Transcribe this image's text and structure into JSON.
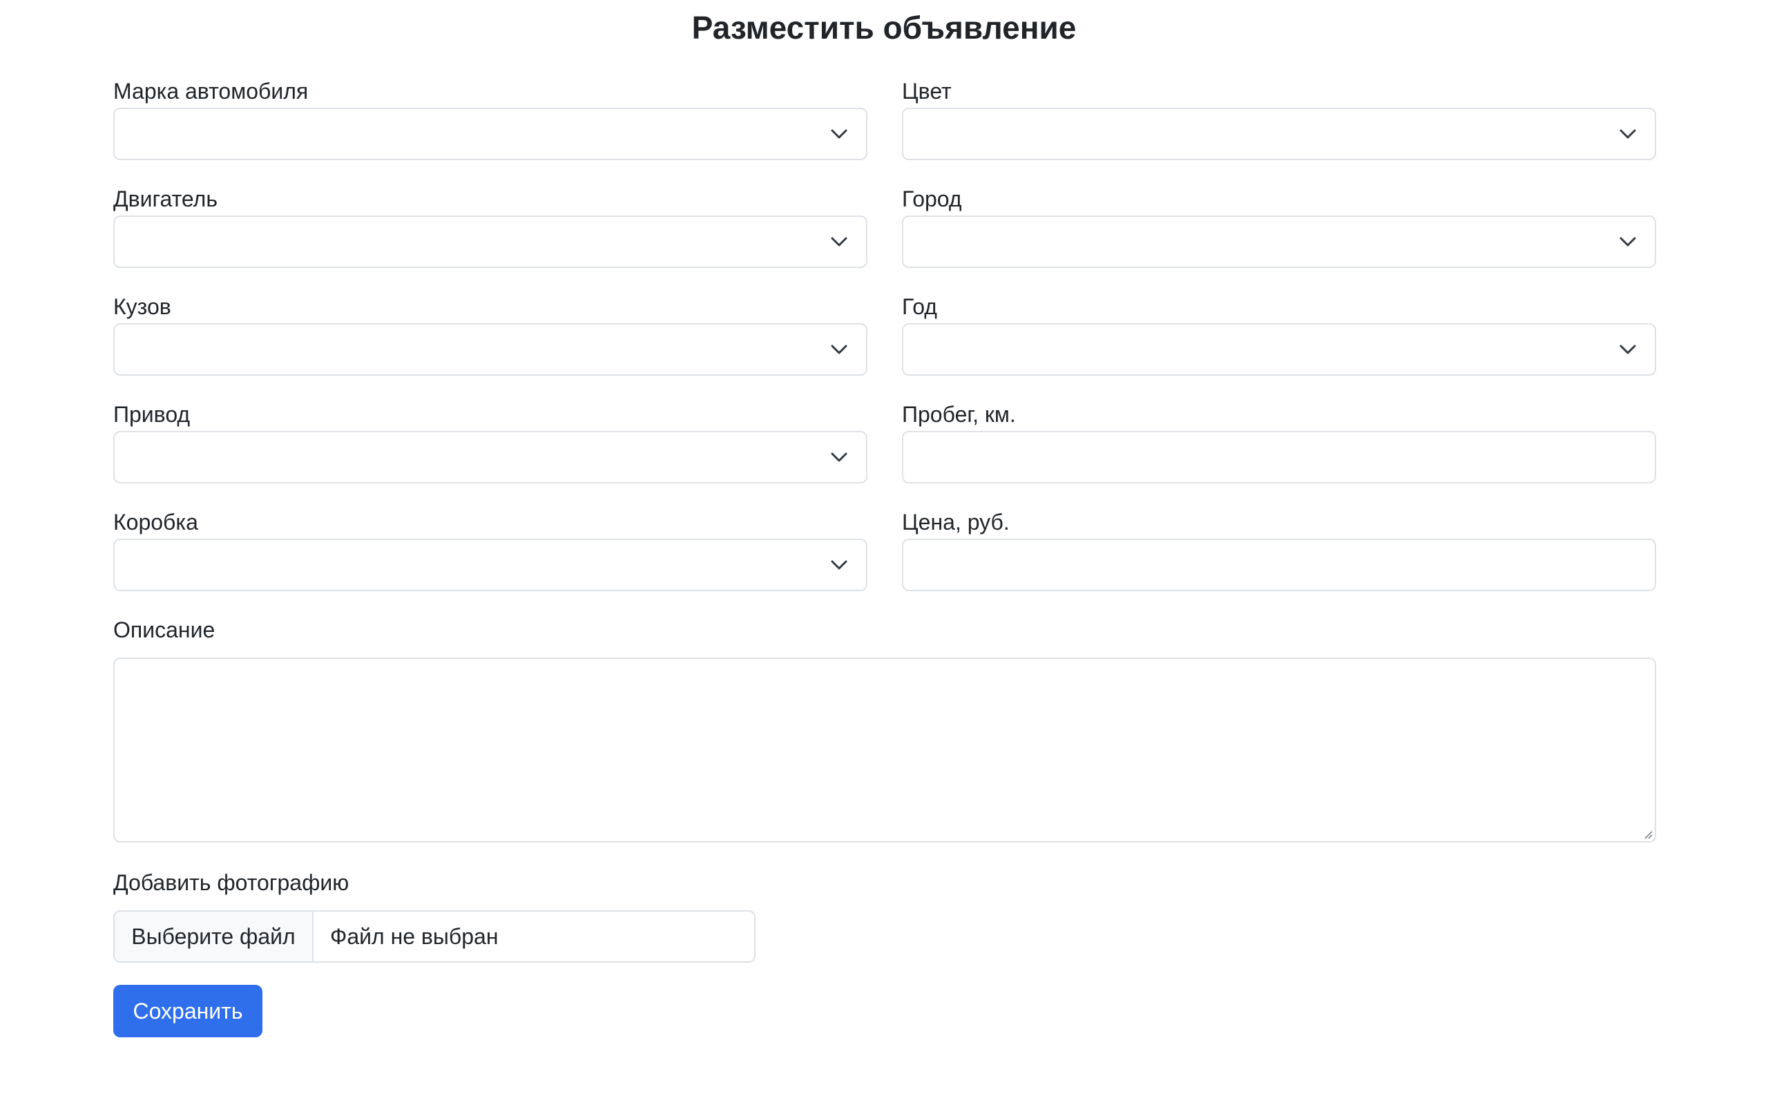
{
  "page": {
    "title": "Разместить объявление"
  },
  "form": {
    "brand": {
      "label": "Марка автомобиля",
      "value": ""
    },
    "color": {
      "label": "Цвет",
      "value": ""
    },
    "engine": {
      "label": "Двигатель",
      "value": ""
    },
    "city": {
      "label": "Город",
      "value": ""
    },
    "body": {
      "label": "Кузов",
      "value": ""
    },
    "year": {
      "label": "Год",
      "value": ""
    },
    "drive": {
      "label": "Привод",
      "value": ""
    },
    "mileage": {
      "label": "Пробег, км.",
      "value": ""
    },
    "gearbox": {
      "label": "Коробка",
      "value": ""
    },
    "price": {
      "label": "Цена, руб.",
      "value": ""
    },
    "description": {
      "label": "Описание",
      "value": ""
    },
    "photo": {
      "label": "Добавить фотографию",
      "button_label": "Выберите файл",
      "status": "Файл не выбран"
    },
    "save_label": "Сохранить"
  },
  "colors": {
    "primary": "#2f6fec",
    "border": "#dee2e6",
    "text": "#212529",
    "file_button_bg": "#f8f9fa"
  },
  "icons": {
    "select_arrow": "chevron-down-icon",
    "textarea_grip": "resize-grip-icon"
  }
}
